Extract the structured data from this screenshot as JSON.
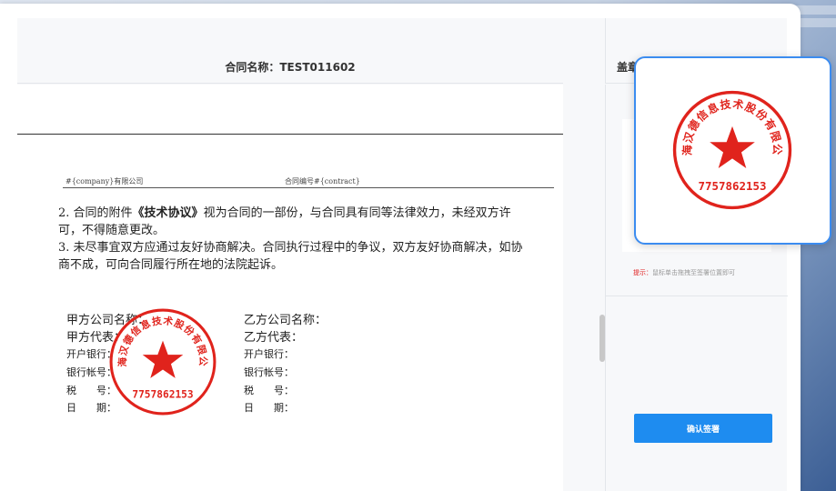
{
  "document": {
    "title_label": "合同名称：",
    "title_value": "TEST011602",
    "meta_left": "#{company}有限公司",
    "meta_right": "合同编号#{contract}",
    "clause2_prefix": "2.  合同的附件",
    "clause2_bold": "《技术协议》",
    "clause2_suffix": "视为合同的一部份，与合同具有同等法律效力，未经双方许可，不得随意更改。",
    "clause3": "3. 未尽事宜双方应通过友好协商解决。合同执行过程中的争议，双方友好协商解决，如协商不成，可向合同履行所在地的法院起诉。"
  },
  "party_a": {
    "company_name": "甲方公司名称：",
    "representative": "甲方代表：",
    "bank": "开户银行：",
    "account": "银行帐号：",
    "tax": "税　　号：",
    "date": "日　　期："
  },
  "party_b": {
    "company_name": "乙方公司名称：",
    "representative": "乙方代表：",
    "bank": "开户银行：",
    "account": "银行帐号：",
    "tax": "税　　号：",
    "date": "日　　期："
  },
  "seal": {
    "company": "上海汉德信息技术股份有限公司",
    "code": "7757862153",
    "color": "#e0231c"
  },
  "side_panel": {
    "header": "盖章",
    "hint_label": "提示：",
    "hint_text": "鼠标单击拖拽至签署位置即可",
    "confirm_button": "确认签署"
  },
  "colors": {
    "accent": "#1e8cf0",
    "drag_border": "#3b8cf0"
  }
}
